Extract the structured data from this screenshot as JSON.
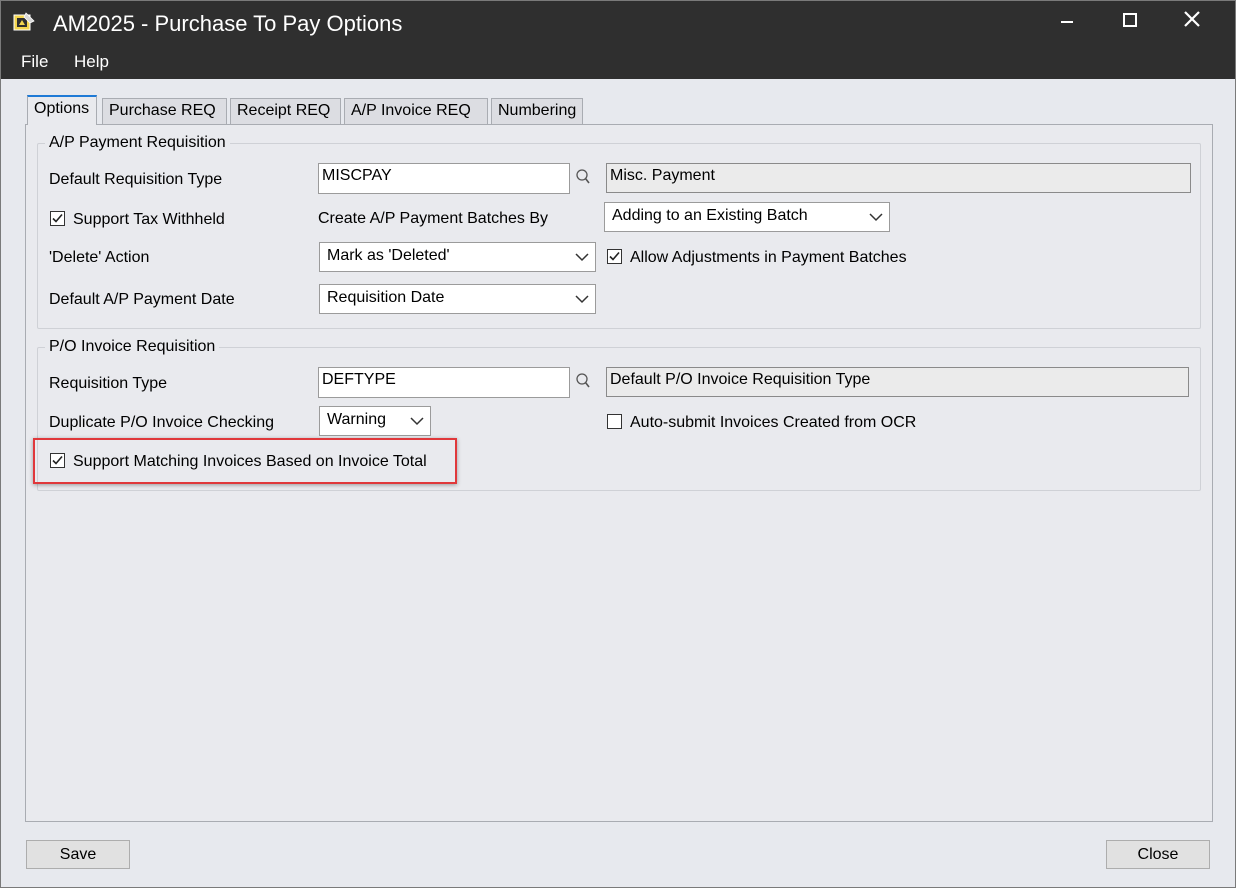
{
  "window": {
    "title": "AM2025 - Purchase To Pay Options",
    "minimize": "—",
    "maximize": "☐",
    "close": "✕"
  },
  "menu": {
    "file": "File",
    "help": "Help"
  },
  "tabs": {
    "options": "Options",
    "purchase_req": "Purchase REQ",
    "receipt_req": "Receipt REQ",
    "ap_invoice_req": "A/P Invoice REQ",
    "numbering": "Numbering",
    "selected": "Options"
  },
  "ap_payment": {
    "group_title": "A/P Payment Requisition",
    "default_req_type_label": "Default Requisition Type",
    "default_req_type_value": "MISCPAY",
    "default_req_type_desc": "Misc. Payment",
    "support_tax_withheld_label": "Support Tax Withheld",
    "support_tax_withheld_checked": true,
    "create_batches_label": "Create A/P Payment Batches By",
    "create_batches_value": "Adding to an Existing Batch",
    "delete_action_label": "'Delete' Action",
    "delete_action_value": "Mark as 'Deleted'",
    "allow_adjustments_label": "Allow Adjustments in Payment Batches",
    "allow_adjustments_checked": true,
    "default_payment_date_label": "Default A/P Payment Date",
    "default_payment_date_value": "Requisition Date"
  },
  "po_invoice": {
    "group_title": "P/O Invoice Requisition",
    "req_type_label": "Requisition Type",
    "req_type_value": "DEFTYPE",
    "req_type_desc": "Default P/O Invoice Requisition Type",
    "dup_checking_label": "Duplicate P/O Invoice Checking",
    "dup_checking_value": "Warning",
    "auto_submit_label": "Auto-submit Invoices Created from OCR",
    "auto_submit_checked": false,
    "support_matching_label": "Support Matching Invoices Based on Invoice Total",
    "support_matching_checked": true
  },
  "buttons": {
    "save": "Save",
    "close": "Close"
  },
  "colors": {
    "titlebar": "#2f2f2f",
    "highlight": "#e0383b",
    "active_tab_accent": "#1e7ad6"
  }
}
